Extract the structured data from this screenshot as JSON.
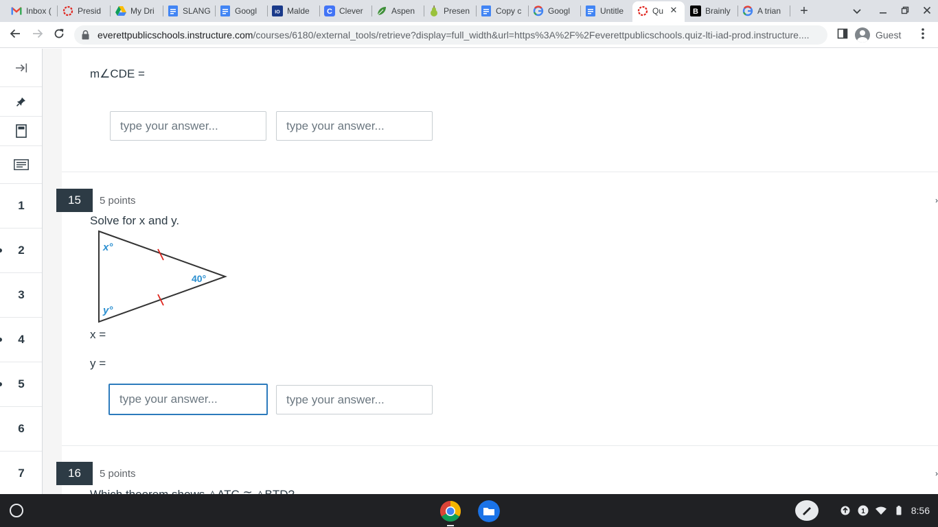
{
  "browser": {
    "tabs": [
      {
        "title": "Inbox (",
        "icon": "gmail-icon"
      },
      {
        "title": "Presid",
        "icon": "quizzes-icon"
      },
      {
        "title": "My Dri",
        "icon": "drive-icon"
      },
      {
        "title": "SLANG",
        "icon": "docs-icon"
      },
      {
        "title": "Googl",
        "icon": "docs-icon"
      },
      {
        "title": "Malde",
        "icon": "malden-icon"
      },
      {
        "title": "Clever",
        "icon": "clever-icon"
      },
      {
        "title": "Aspen",
        "icon": "aspen-icon"
      },
      {
        "title": "Presen",
        "icon": "pear-icon"
      },
      {
        "title": "Copy c",
        "icon": "docs-icon"
      },
      {
        "title": "Googl",
        "icon": "google-icon"
      },
      {
        "title": "Untitle",
        "icon": "docs-icon"
      },
      {
        "title": "Qu",
        "icon": "quizzes-icon",
        "active": true
      },
      {
        "title": "Brainly",
        "icon": "brainly-icon"
      },
      {
        "title": "A trian",
        "icon": "google-icon"
      }
    ],
    "url_host": "everettpublicschools.instructure.com",
    "url_path": "/courses/6180/external_tools/retrieve?display=full_width&url=https%3A%2F%2Feverettpublicschools.quiz-lti-iad-prod.instructure....",
    "profile_label": "Guest"
  },
  "sidebar": {
    "questions": [
      "1",
      "2",
      "3",
      "4",
      "5",
      "6",
      "7"
    ]
  },
  "quiz": {
    "prev_question": {
      "prompt": "m∠CDE =",
      "placeholder": "type your answer..."
    },
    "question_15": {
      "number": "15",
      "points": "5 points",
      "prompt": "Solve for x and y.",
      "figure": {
        "angle_top": "x°",
        "angle_bottom": "y°",
        "angle_right": "40°"
      },
      "x_label": "x =",
      "y_label": "y =",
      "placeholder": "type your answer..."
    },
    "question_16": {
      "number": "16",
      "points": "5 points",
      "prompt_partial": "Which theorem shows △ATC ≅ △BTD?"
    }
  },
  "shelf": {
    "time": "8:56",
    "notification_count": "1"
  }
}
